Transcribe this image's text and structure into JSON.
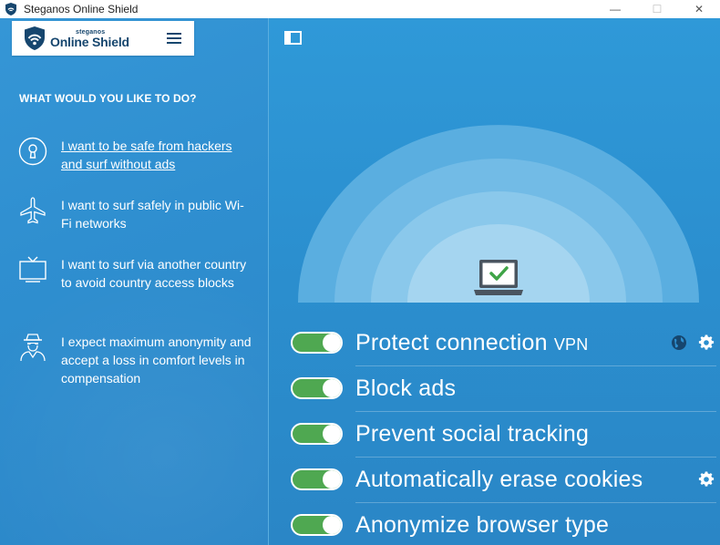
{
  "window": {
    "title": "Steganos Online Shield",
    "controls": {
      "minimize": "—",
      "maximize": "☐",
      "close": "✕"
    }
  },
  "logo": {
    "small": "steganos",
    "big": "Online Shield"
  },
  "sidebar": {
    "question": "WHAT WOULD YOU LIKE TO DO?",
    "options": [
      {
        "icon": "keyhole-icon",
        "text": "I want to be safe from hackers and surf without ads",
        "selected": true
      },
      {
        "icon": "airplane-icon",
        "text": "I want to surf safely in public Wi-Fi networks",
        "selected": false
      },
      {
        "icon": "tv-icon",
        "text": "I want to surf via another country to avoid country access blocks",
        "selected": false
      },
      {
        "icon": "spy-icon",
        "text": "I expect maximum anonymity and accept a loss in comfort levels in compensation",
        "selected": false
      }
    ]
  },
  "status": {
    "icon": "laptop-check-icon",
    "protected": true
  },
  "features": [
    {
      "label": "Protect connection",
      "suffix": "VPN",
      "enabled": true,
      "icons": [
        "globe-icon",
        "gear-icon"
      ]
    },
    {
      "label": "Block ads",
      "suffix": "",
      "enabled": true,
      "icons": []
    },
    {
      "label": "Prevent social tracking",
      "suffix": "",
      "enabled": true,
      "icons": []
    },
    {
      "label": "Automatically erase cookies",
      "suffix": "",
      "enabled": true,
      "icons": [
        "gear-icon"
      ]
    },
    {
      "label": "Anonymize browser type",
      "suffix": "",
      "enabled": true,
      "icons": []
    }
  ],
  "colors": {
    "accent": "#2e8fcf",
    "toggle_on": "#4fa851",
    "logo_text": "#16466e"
  }
}
